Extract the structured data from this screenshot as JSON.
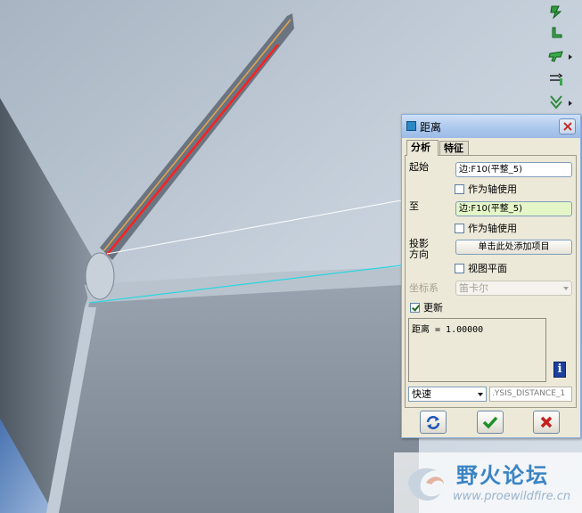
{
  "dialog": {
    "title": "距离",
    "tabs": [
      {
        "label": "分析"
      },
      {
        "label": "特征"
      }
    ],
    "from_label": "起始",
    "from_value": "边:F10(平整_5)",
    "from_axis_label": "作为轴使用",
    "to_label": "至",
    "to_value": "边:F10(平整_5)",
    "to_axis_label": "作为轴使用",
    "projection_label_1": "投影",
    "projection_label_2": "方向",
    "projection_button": "单击此处添加项目",
    "view_plane_label": "视图平面",
    "csys_label": "坐标系",
    "csys_value": "笛卡尔",
    "update_label": "更新",
    "update_checked": true,
    "result_text": "距离 = 1.00000",
    "mode_value": "快速",
    "feature_name": ".YSIS_DISTANCE_1"
  },
  "watermark": {
    "title": "野火论坛",
    "url": "www.proewildfire.cn"
  },
  "colors": {
    "accent": "#3a84c4",
    "edge_highlight": "#ff2020",
    "edge_secondary": "#2bd6e0"
  }
}
